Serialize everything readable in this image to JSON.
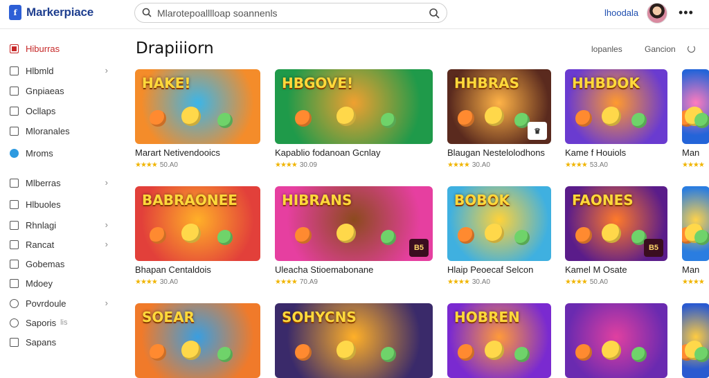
{
  "header": {
    "brand": "Markerpiace",
    "logo_glyph": "f",
    "search_placeholder": "Mlarotepoalllloap soannenls",
    "user_link": "lhoodala",
    "more": "•••"
  },
  "sidebar": {
    "items": [
      {
        "label": "Hiburras",
        "icon": "store-icon",
        "active": true
      },
      {
        "label": "Hlbmld",
        "icon": "image-icon",
        "chevron": "›"
      },
      {
        "label": "Gnpiaeas",
        "icon": "copy-icon"
      },
      {
        "label": "Ocllaps",
        "icon": "grid-icon"
      },
      {
        "label": "Mloranales",
        "icon": "photo-icon"
      },
      {
        "label": "Mroms",
        "icon": "chat-icon"
      },
      {
        "label": "Mlberras",
        "icon": "picture-icon",
        "chevron": "›"
      },
      {
        "label": "Hlbuoles",
        "icon": "book-icon"
      },
      {
        "label": "Rhnlagi",
        "icon": "tag-icon",
        "chevron": "›"
      },
      {
        "label": "Rancat",
        "icon": "square-icon",
        "chevron": "›"
      },
      {
        "label": "Gobemas",
        "icon": "users-icon"
      },
      {
        "label": "Mdoey",
        "icon": "bookmark-icon"
      },
      {
        "label": "Povrdoule",
        "icon": "clock-icon",
        "chevron": "›"
      },
      {
        "label": "Saporis",
        "icon": "settings-icon",
        "tail": "lis"
      },
      {
        "label": "Sapans",
        "icon": "document-icon"
      }
    ]
  },
  "main": {
    "title": "Drapiiiorn",
    "filter_1": "lopanles",
    "filter_2": "Gancion"
  },
  "cards": [
    {
      "title": "Marart Netivendooics",
      "rating": "50.A0",
      "banner": "HAKE!",
      "colors": [
        "#f48c2a",
        "#3cb5e8"
      ]
    },
    {
      "title": "Kapablio fodanoan Gcnlay",
      "rating": "30.09",
      "banner": "HBGOVE!",
      "colors": [
        "#1f9a4a",
        "#f0a030"
      ]
    },
    {
      "title": "Blaugan Nestelolodhons",
      "rating": "30.A0",
      "banner": "HHBRAS",
      "colors": [
        "#5a2a1e",
        "#ffb347"
      ],
      "badge": "♛"
    },
    {
      "title": "Kame f Houiols",
      "rating": "53.A0",
      "banner": "HHBDOK",
      "colors": [
        "#6a3bd0",
        "#ff9a2e"
      ]
    },
    {
      "title": "Man",
      "rating": "",
      "banner": "",
      "colors": [
        "#2464d8",
        "#ff7bbd"
      ]
    },
    {
      "title": "Bhapan Centaldois",
      "rating": "30.A0",
      "banner": "BABRAONEE",
      "colors": [
        "#e2403a",
        "#ffb028"
      ]
    },
    {
      "title": "Uleacha Stioemabonane",
      "rating": "70.A9",
      "banner": "HIBRANS",
      "colors": [
        "#e63fa0",
        "#8c4a1e"
      ],
      "badge": "B5"
    },
    {
      "title": "Hlaip Peoecaf Selcon",
      "rating": "30.A0",
      "banner": "BOBOK",
      "colors": [
        "#3fb0e0",
        "#ffd23a"
      ]
    },
    {
      "title": "Kamel M Osate",
      "rating": "50.A0",
      "banner": "FAONES",
      "colors": [
        "#5a1c8a",
        "#ff7a2a"
      ],
      "badge": "B5"
    },
    {
      "title": "Man",
      "rating": "",
      "banner": "",
      "colors": [
        "#2a7de0",
        "#ffd24a"
      ]
    },
    {
      "title": "",
      "rating": "",
      "banner": "SOEAR",
      "colors": [
        "#f07a2a",
        "#3a9ee0"
      ]
    },
    {
      "title": "",
      "rating": "",
      "banner": "SOHYCNS",
      "colors": [
        "#3a2a6a",
        "#ffb028"
      ]
    },
    {
      "title": "",
      "rating": "",
      "banner": "HOBREN",
      "colors": [
        "#7a2ad0",
        "#ff9a3a"
      ]
    },
    {
      "title": "",
      "rating": "",
      "banner": "",
      "colors": [
        "#6a2ab0",
        "#e040a0"
      ]
    },
    {
      "title": "",
      "rating": "",
      "banner": "",
      "colors": [
        "#2a5ad0",
        "#ffcc40"
      ]
    }
  ]
}
